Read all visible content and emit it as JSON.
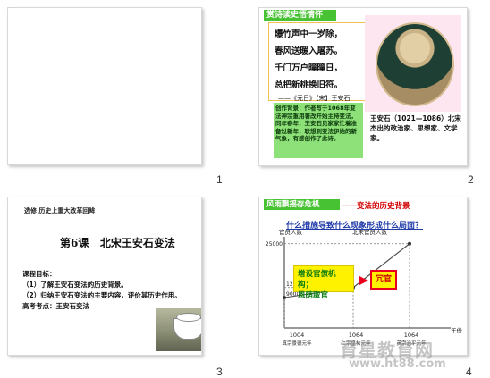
{
  "slides": [
    {
      "number": "1"
    },
    {
      "number": "2",
      "header": "赏诗读史悟情怀",
      "poem": [
        "爆竹声中一岁除，",
        "春风送暖入屠苏。",
        "千门万户曈曈日，",
        "总把新桃换旧符。"
      ],
      "citation": "——《元日》【宋】王安石",
      "background_text": "创作背景：作者写于1068年变法神宗重用著改开始主持变法，同年春年，王安石见家家忙着准备过新年，联想到变法伊始的新气象，有感创作了此诗。",
      "background_highlight": "主持变法",
      "portrait_caption": "王安石（1021—1086）北宋杰出的政治家、思想家、文学家。"
    },
    {
      "number": "3",
      "top_label": "选修  历史上重大改革回眸",
      "title": "第6课   北宋王安石变法",
      "goals_heading": "课程目标：",
      "goals": [
        "（1）了解王安石变法的历史背景。",
        "（2）归纳王安石变法的主要内容，评价其历史作用。"
      ],
      "exam": "高考考点：王安石变法"
    },
    {
      "number": "4",
      "header": "风雨飘摇存危机",
      "header_suffix": "——变法的历史背景",
      "question": "什么措施导致什么现象形成什么局面？",
      "y_label": "官员人数",
      "chart_title": "北宋官员人数",
      "points_labels": [
        "25000",
        "12000",
        "9000"
      ],
      "x_ticks": [
        "1004",
        "1064",
        "1064"
      ],
      "x_tick_labels": [
        "真宗景德元年",
        "仁宗皇祐元年",
        "英宗治平元年"
      ],
      "x_label": "年份",
      "box_measure": [
        "增设官僚机构；",
        "恩荫取官"
      ],
      "box_result": "冗官"
    }
  ],
  "watermark": {
    "main": "育星教育网",
    "url": "www.ht88.com"
  },
  "colors": {
    "green_header": "#47c233",
    "yellow": "#fff200",
    "red": "#e8001c",
    "blue": "#1f3aa8"
  },
  "chart_data": {
    "type": "line",
    "title": "北宋官员人数",
    "ylabel": "官员人数",
    "xlabel": "年份",
    "series": [
      {
        "values": [
          9000,
          12000,
          25000
        ]
      }
    ]
  }
}
